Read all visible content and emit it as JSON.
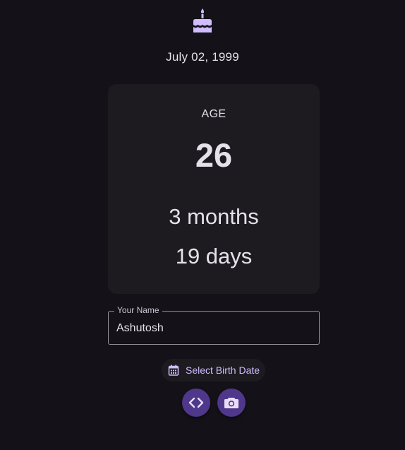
{
  "header": {
    "icon": "cake-icon",
    "birth_date": "July 02, 1999"
  },
  "age_card": {
    "label": "AGE",
    "years": "26",
    "months": "3 months",
    "days": "19 days"
  },
  "name_field": {
    "label": "Your Name",
    "value": "Ashutosh"
  },
  "birth_button": {
    "label": "Select Birth Date",
    "icon": "calendar-icon"
  },
  "actions": [
    {
      "icon": "code-icon"
    },
    {
      "icon": "camera-icon"
    }
  ],
  "colors": {
    "background": "#141218",
    "card": "#1d1b20",
    "accent": "#d0bcff",
    "fab": "#4f378b",
    "text": "#e6e0e9"
  }
}
